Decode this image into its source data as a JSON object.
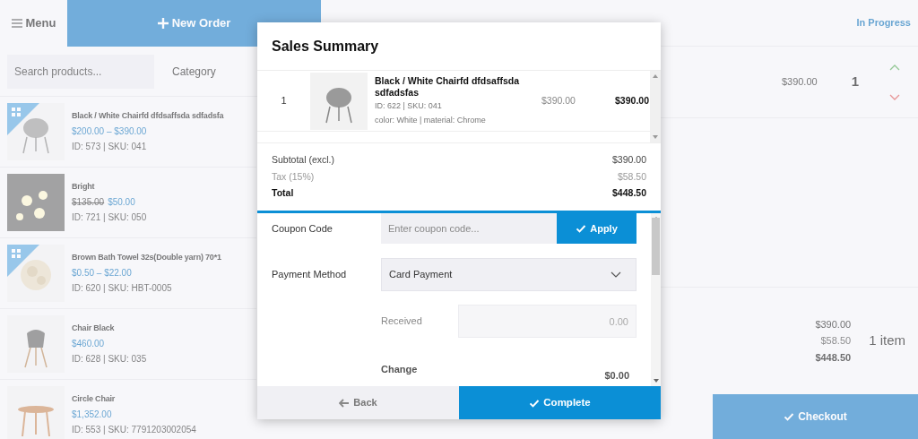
{
  "header": {
    "menu_label": "Menu",
    "new_order_label": "New Order",
    "status": "In Progress"
  },
  "search": {
    "placeholder": "Search products...",
    "category": "Category"
  },
  "products": [
    {
      "name": "Black / White Chairfd dfdsaffsda sdfadsfa",
      "price": "$200.00 – $390.00",
      "meta": "ID: 573 | SKU: 041",
      "variable": true
    },
    {
      "name": "Bright",
      "regular_price": "$135.00",
      "price": "$50.00",
      "meta": "ID: 721 | SKU: 050",
      "variable": false
    },
    {
      "name": "Brown Bath Towel 32s(Double yarn) 70*1",
      "price": "$0.50 – $22.00",
      "meta": "ID: 620 | SKU: HBT-0005",
      "variable": true
    },
    {
      "name": "Chair Black",
      "price": "$460.00",
      "meta": "ID: 628 | SKU: 035",
      "variable": false
    },
    {
      "name": "Circle Chair",
      "price": "$1,352.00",
      "meta": "ID: 553 | SKU: 7791203002054",
      "variable": false
    }
  ],
  "cart": [
    {
      "price": "$390.00",
      "qty": "1"
    }
  ],
  "cart_totals": {
    "values": [
      "$390.00",
      "$58.50",
      "$448.50"
    ],
    "count": "1 item",
    "checkout": "Checkout"
  },
  "modal": {
    "title": "Sales Summary",
    "items": [
      {
        "index": "1",
        "name": "Black / White Chairfd dfdsaffsda sdfadsfas",
        "meta": "ID: 622 | SKU: 041",
        "attributes": "color: White | material: Chrome",
        "price": "$390.00",
        "total": "$390.00"
      }
    ],
    "totals": [
      {
        "label": "Subtotal (excl.)",
        "value": "$390.00",
        "kind": "normal"
      },
      {
        "label": "Tax (15%)",
        "value": "$58.50",
        "kind": "muted"
      },
      {
        "label": "Total",
        "value": "$448.50",
        "kind": "total"
      }
    ],
    "coupon": {
      "label": "Coupon Code",
      "placeholder": "Enter coupon code...",
      "button": "Apply"
    },
    "payment": {
      "label": "Payment Method",
      "value": "Card Payment"
    },
    "received": {
      "label": "Received",
      "placeholder": "0.00"
    },
    "change": {
      "label": "Change",
      "value": "$0.00"
    },
    "back": "Back",
    "complete": "Complete"
  }
}
